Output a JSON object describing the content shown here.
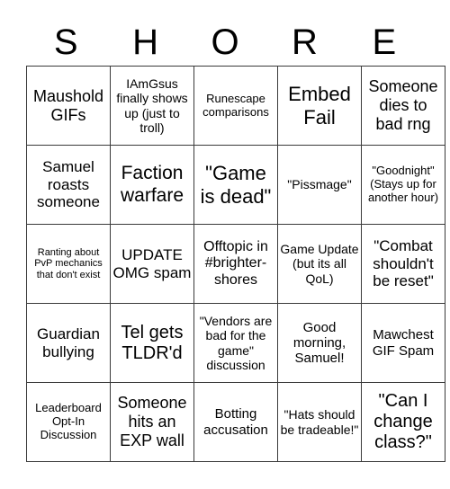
{
  "title_letters": [
    "S",
    "H",
    "O",
    "R",
    "E"
  ],
  "board": [
    [
      "Maushold GIFs",
      "IAmGsus finally shows up (just to troll)",
      "Runescape comparisons",
      "Embed Fail",
      "Someone dies to bad rng"
    ],
    [
      "Samuel roasts someone",
      "Faction warfare",
      "\"Game is dead\"",
      "\"Pissmage\"",
      "\"Goodnight\" (Stays up for another hour)"
    ],
    [
      "Ranting about PvP mechanics that don't exist",
      "UPDATE OMG spam",
      "Offtopic in #brighter-shores",
      "Game Update (but its all QoL)",
      "\"Combat shouldn't be reset\""
    ],
    [
      "Guardian bullying",
      "Tel gets TLDR'd",
      "\"Vendors are bad for the game\" discussion",
      "Good morning, Samuel!",
      "Mawchest GIF Spam"
    ],
    [
      "Leaderboard Opt-In Discussion",
      "Someone hits an EXP wall",
      "Botting accusation",
      "\"Hats should be tradeable!\"",
      "\"Can I change class?\""
    ]
  ]
}
